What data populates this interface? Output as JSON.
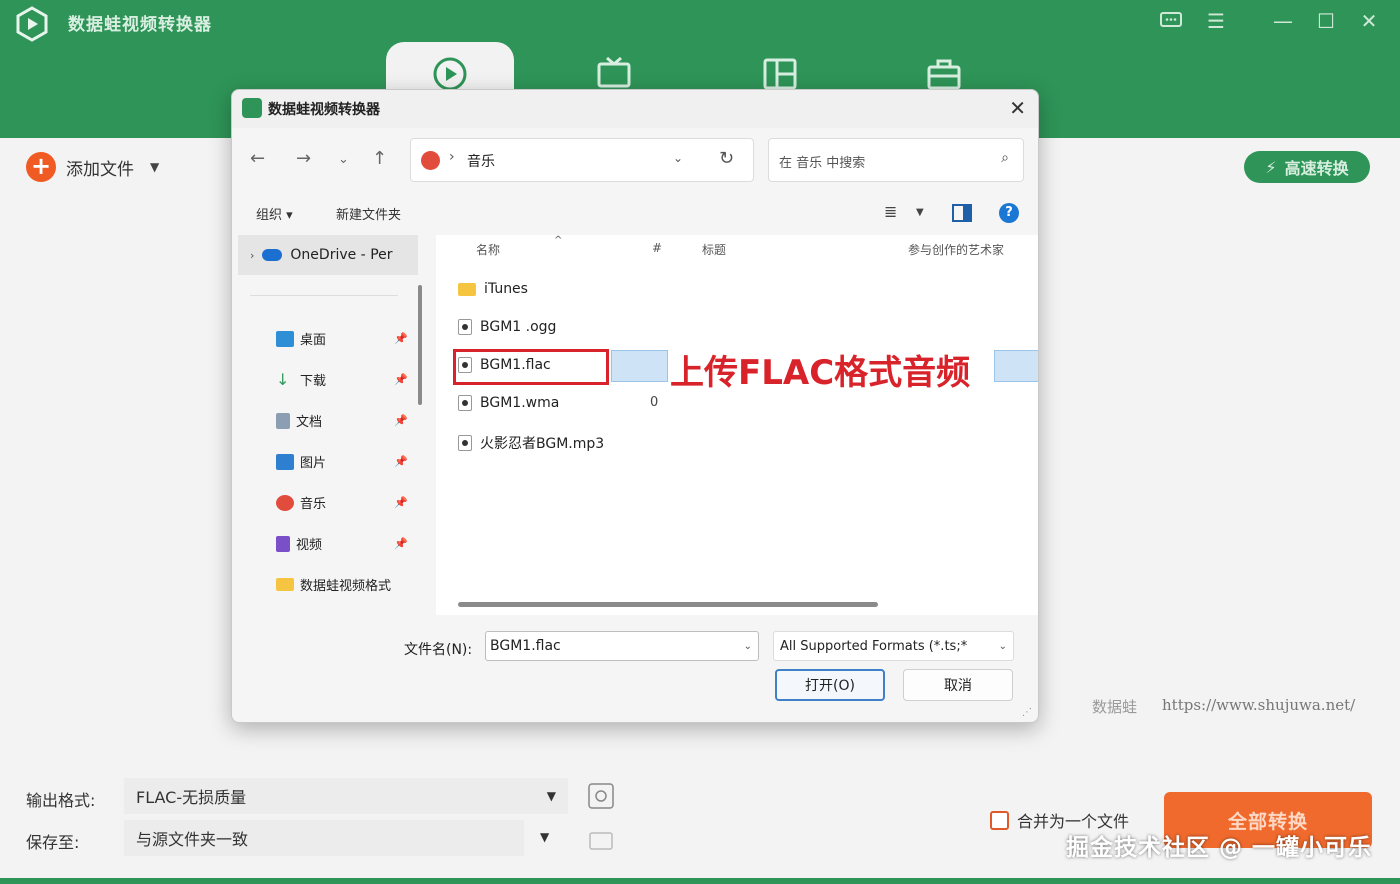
{
  "app": {
    "title": "数据蛙视频转换器",
    "add_file_label": "添加文件",
    "fast_convert_label": "高速转换",
    "brand_label": "数据蛙",
    "site_url": "https://www.shujuwa.net/",
    "output_format_label": "输出格式:",
    "output_format_value": "FLAC-无损质量",
    "save_to_label": "保存至:",
    "save_to_value": "与源文件夹一致",
    "merge_label": "合并为一个文件",
    "convert_all_label": "全部转换",
    "watermark": "掘金技术社区 @ 一罐小可乐",
    "accent_color": "#2e9457",
    "action_color": "#f06a2d",
    "tabs": [
      {
        "icon": "video-convert-icon",
        "active": true
      },
      {
        "icon": "tv-icon",
        "active": false
      },
      {
        "icon": "layout-icon",
        "active": false
      },
      {
        "icon": "toolbox-icon",
        "active": false
      }
    ]
  },
  "dialog": {
    "title": "数据蛙视频转换器",
    "breadcrumb": "音乐",
    "search_placeholder": "在 音乐 中搜索",
    "toolbar": {
      "organize": "组织 ▾",
      "new_folder": "新建文件夹"
    },
    "nav": {
      "onedrive": "OneDrive - Per",
      "items": [
        {
          "label": "桌面",
          "icon": "desktop-icon",
          "color": "#2f8fd6"
        },
        {
          "label": "下载",
          "icon": "download-icon",
          "color": "#2f9b5b"
        },
        {
          "label": "文档",
          "icon": "documents-icon",
          "color": "#8c9fb2"
        },
        {
          "label": "图片",
          "icon": "pictures-icon",
          "color": "#2f7fd0"
        },
        {
          "label": "音乐",
          "icon": "music-icon",
          "color": "#e24c3c"
        },
        {
          "label": "视频",
          "icon": "videos-icon",
          "color": "#7a4fc7"
        },
        {
          "label": "数据蛙视频格式",
          "icon": "folder-icon",
          "color": "#f5c542"
        }
      ]
    },
    "columns": {
      "name": "名称",
      "number": "#",
      "title": "标题",
      "artists": "参与创作的艺术家"
    },
    "files": [
      {
        "name": "iTunes",
        "type": "folder",
        "number": ""
      },
      {
        "name": "BGM1 .ogg",
        "type": "file",
        "number": ""
      },
      {
        "name": "BGM1.flac",
        "type": "file",
        "number": "",
        "selected": true
      },
      {
        "name": "BGM1.wma",
        "type": "file",
        "number": "0"
      },
      {
        "name": "火影忍者BGM.mp3",
        "type": "file",
        "number": ""
      }
    ],
    "annotation": "上传FLAC格式音频",
    "file_name_label": "文件名(N):",
    "file_name_value": "BGM1.flac",
    "filter_value": "All Supported Formats (*.ts;*",
    "open_label": "打开(O)",
    "cancel_label": "取消"
  }
}
